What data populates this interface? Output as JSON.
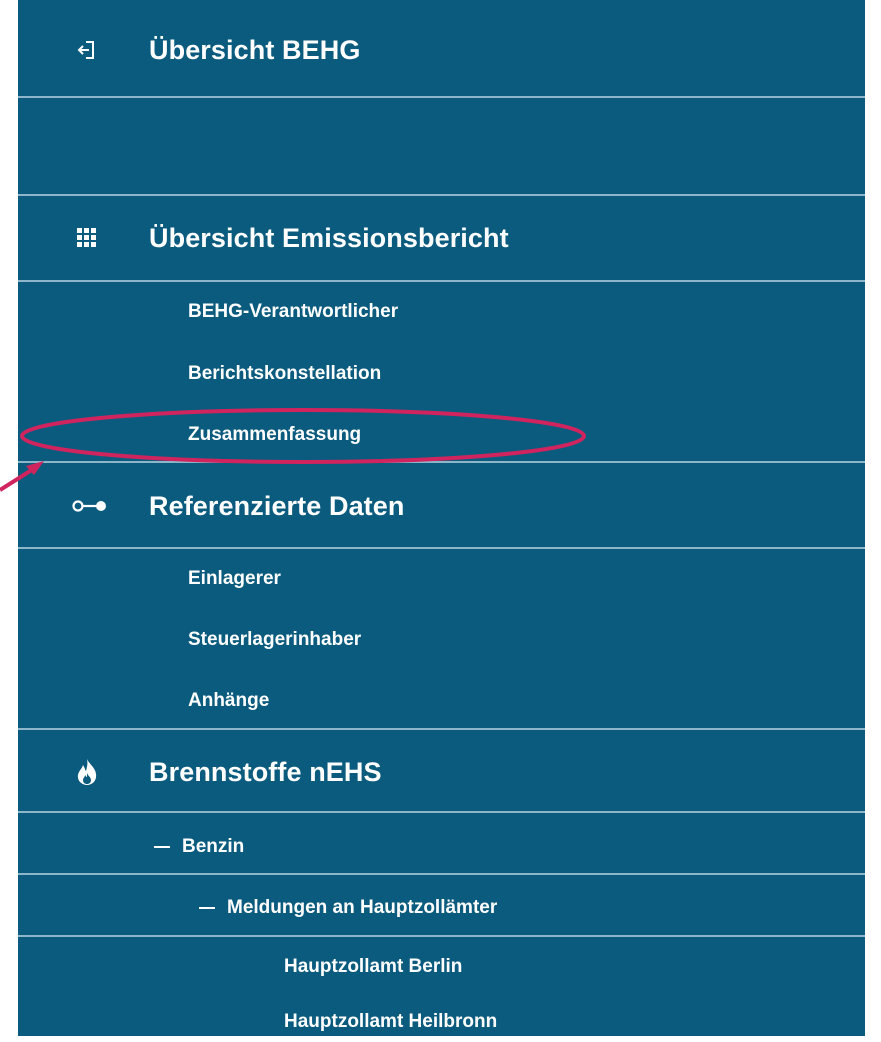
{
  "nav": {
    "overview_behg": {
      "label": "Übersicht BEHG",
      "icon": "exit-icon"
    },
    "overview_report": {
      "label": "Übersicht Emissionsbericht",
      "icon": "grid-icon",
      "items": [
        "BEHG-Verantwortlicher",
        "Berichtskonstellation",
        "Zusammenfassung"
      ]
    },
    "referenced_data": {
      "label": "Referenzierte Daten",
      "icon": "link-icon",
      "items": [
        "Einlagerer",
        "Steuerlagerinhaber",
        "Anhänge"
      ]
    },
    "fuels": {
      "label": "Brennstoffe nEHS",
      "icon": "flame-icon",
      "fuel_item": "Benzin",
      "reports_item": "Meldungen an Hauptzollämter",
      "offices": [
        "Hauptzollamt Berlin",
        "Hauptzollamt Heilbronn"
      ]
    }
  },
  "colors": {
    "background": "#0b5b7e",
    "divider": "#8fb5c9",
    "text": "#ffffff",
    "highlight": "#d0245f"
  },
  "annotation": {
    "highlighted_item": "Zusammenfassung"
  }
}
